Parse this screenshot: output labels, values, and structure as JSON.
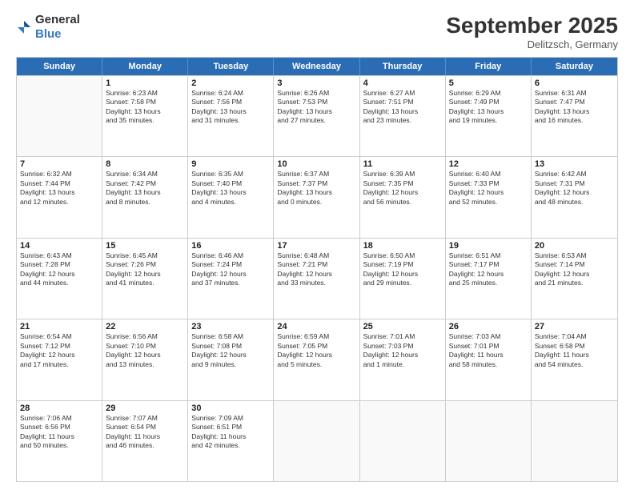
{
  "logo": {
    "general": "General",
    "blue": "Blue"
  },
  "title": "September 2025",
  "subtitle": "Delitzsch, Germany",
  "days_of_week": [
    "Sunday",
    "Monday",
    "Tuesday",
    "Wednesday",
    "Thursday",
    "Friday",
    "Saturday"
  ],
  "weeks": [
    [
      {
        "day": "",
        "info": ""
      },
      {
        "day": "1",
        "info": "Sunrise: 6:23 AM\nSunset: 7:58 PM\nDaylight: 13 hours\nand 35 minutes."
      },
      {
        "day": "2",
        "info": "Sunrise: 6:24 AM\nSunset: 7:56 PM\nDaylight: 13 hours\nand 31 minutes."
      },
      {
        "day": "3",
        "info": "Sunrise: 6:26 AM\nSunset: 7:53 PM\nDaylight: 13 hours\nand 27 minutes."
      },
      {
        "day": "4",
        "info": "Sunrise: 6:27 AM\nSunset: 7:51 PM\nDaylight: 13 hours\nand 23 minutes."
      },
      {
        "day": "5",
        "info": "Sunrise: 6:29 AM\nSunset: 7:49 PM\nDaylight: 13 hours\nand 19 minutes."
      },
      {
        "day": "6",
        "info": "Sunrise: 6:31 AM\nSunset: 7:47 PM\nDaylight: 13 hours\nand 16 minutes."
      }
    ],
    [
      {
        "day": "7",
        "info": "Sunrise: 6:32 AM\nSunset: 7:44 PM\nDaylight: 13 hours\nand 12 minutes."
      },
      {
        "day": "8",
        "info": "Sunrise: 6:34 AM\nSunset: 7:42 PM\nDaylight: 13 hours\nand 8 minutes."
      },
      {
        "day": "9",
        "info": "Sunrise: 6:35 AM\nSunset: 7:40 PM\nDaylight: 13 hours\nand 4 minutes."
      },
      {
        "day": "10",
        "info": "Sunrise: 6:37 AM\nSunset: 7:37 PM\nDaylight: 13 hours\nand 0 minutes."
      },
      {
        "day": "11",
        "info": "Sunrise: 6:39 AM\nSunset: 7:35 PM\nDaylight: 12 hours\nand 56 minutes."
      },
      {
        "day": "12",
        "info": "Sunrise: 6:40 AM\nSunset: 7:33 PM\nDaylight: 12 hours\nand 52 minutes."
      },
      {
        "day": "13",
        "info": "Sunrise: 6:42 AM\nSunset: 7:31 PM\nDaylight: 12 hours\nand 48 minutes."
      }
    ],
    [
      {
        "day": "14",
        "info": "Sunrise: 6:43 AM\nSunset: 7:28 PM\nDaylight: 12 hours\nand 44 minutes."
      },
      {
        "day": "15",
        "info": "Sunrise: 6:45 AM\nSunset: 7:26 PM\nDaylight: 12 hours\nand 41 minutes."
      },
      {
        "day": "16",
        "info": "Sunrise: 6:46 AM\nSunset: 7:24 PM\nDaylight: 12 hours\nand 37 minutes."
      },
      {
        "day": "17",
        "info": "Sunrise: 6:48 AM\nSunset: 7:21 PM\nDaylight: 12 hours\nand 33 minutes."
      },
      {
        "day": "18",
        "info": "Sunrise: 6:50 AM\nSunset: 7:19 PM\nDaylight: 12 hours\nand 29 minutes."
      },
      {
        "day": "19",
        "info": "Sunrise: 6:51 AM\nSunset: 7:17 PM\nDaylight: 12 hours\nand 25 minutes."
      },
      {
        "day": "20",
        "info": "Sunrise: 6:53 AM\nSunset: 7:14 PM\nDaylight: 12 hours\nand 21 minutes."
      }
    ],
    [
      {
        "day": "21",
        "info": "Sunrise: 6:54 AM\nSunset: 7:12 PM\nDaylight: 12 hours\nand 17 minutes."
      },
      {
        "day": "22",
        "info": "Sunrise: 6:56 AM\nSunset: 7:10 PM\nDaylight: 12 hours\nand 13 minutes."
      },
      {
        "day": "23",
        "info": "Sunrise: 6:58 AM\nSunset: 7:08 PM\nDaylight: 12 hours\nand 9 minutes."
      },
      {
        "day": "24",
        "info": "Sunrise: 6:59 AM\nSunset: 7:05 PM\nDaylight: 12 hours\nand 5 minutes."
      },
      {
        "day": "25",
        "info": "Sunrise: 7:01 AM\nSunset: 7:03 PM\nDaylight: 12 hours\nand 1 minute."
      },
      {
        "day": "26",
        "info": "Sunrise: 7:03 AM\nSunset: 7:01 PM\nDaylight: 11 hours\nand 58 minutes."
      },
      {
        "day": "27",
        "info": "Sunrise: 7:04 AM\nSunset: 6:58 PM\nDaylight: 11 hours\nand 54 minutes."
      }
    ],
    [
      {
        "day": "28",
        "info": "Sunrise: 7:06 AM\nSunset: 6:56 PM\nDaylight: 11 hours\nand 50 minutes."
      },
      {
        "day": "29",
        "info": "Sunrise: 7:07 AM\nSunset: 6:54 PM\nDaylight: 11 hours\nand 46 minutes."
      },
      {
        "day": "30",
        "info": "Sunrise: 7:09 AM\nSunset: 6:51 PM\nDaylight: 11 hours\nand 42 minutes."
      },
      {
        "day": "",
        "info": ""
      },
      {
        "day": "",
        "info": ""
      },
      {
        "day": "",
        "info": ""
      },
      {
        "day": "",
        "info": ""
      }
    ]
  ]
}
